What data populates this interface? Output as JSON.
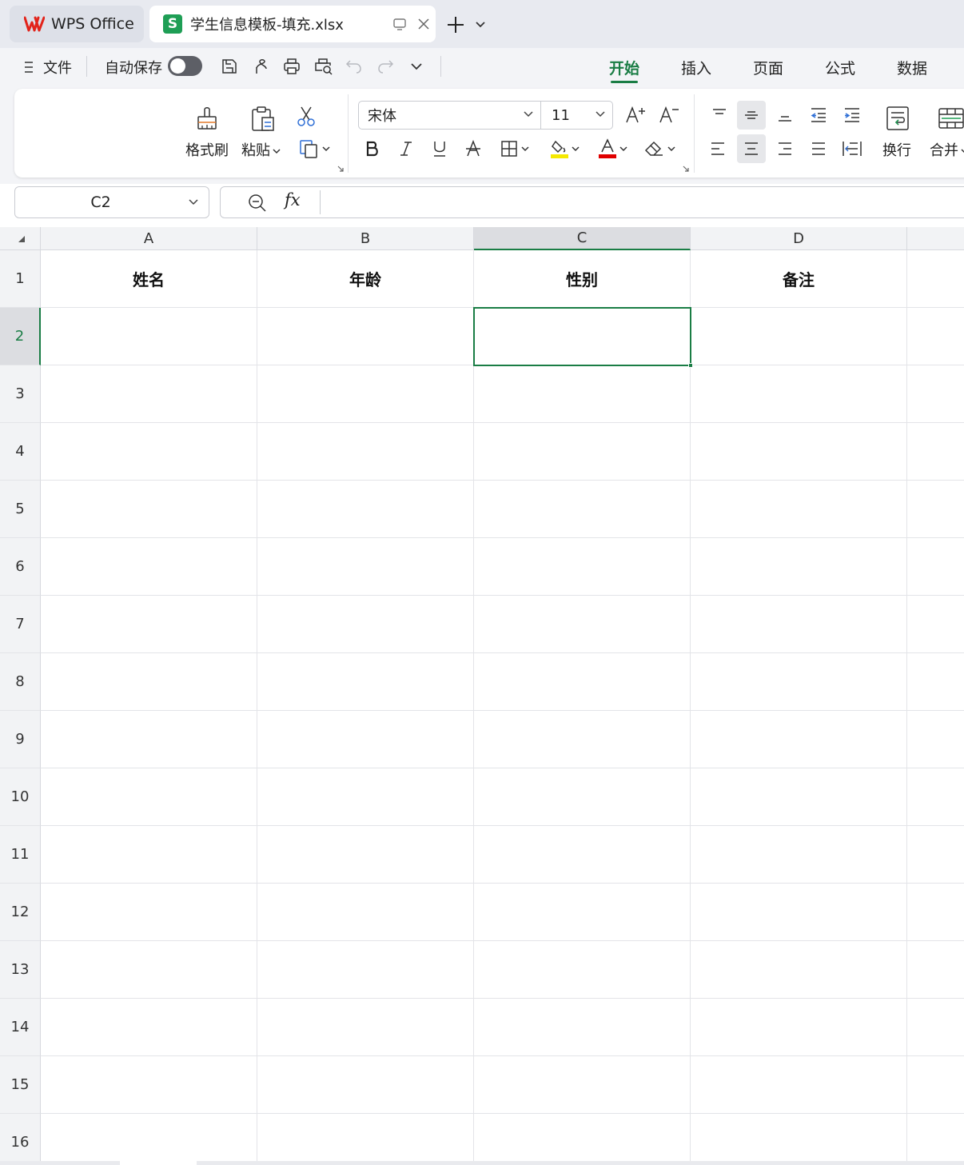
{
  "app": {
    "home_tab_label": "WPS Office",
    "doc_tab_title": "学生信息模板-填充.xlsx",
    "doc_tab_logo": "S",
    "brand_color": "#1a7d45"
  },
  "menubar": {
    "file_label": "文件",
    "autosave_label": "自动保存",
    "autosave_on": false,
    "ribbon_tabs": [
      "开始",
      "插入",
      "页面",
      "公式",
      "数据"
    ],
    "active_tab": "开始"
  },
  "ribbon": {
    "format_painter_label": "格式刷",
    "paste_label": "粘贴",
    "font_name": "宋体",
    "font_size": "11",
    "wrap_label": "换行",
    "merge_label": "合并",
    "fill_color": "#f5e900",
    "font_color": "#e00000"
  },
  "formula_bar": {
    "name_box": "C2",
    "fx_label": "fx",
    "formula": ""
  },
  "sheet": {
    "columns": [
      "A",
      "B",
      "C",
      "D"
    ],
    "rows": [
      "1",
      "2",
      "3",
      "4",
      "5",
      "6",
      "7",
      "8",
      "9",
      "10",
      "11",
      "12",
      "13",
      "14",
      "15",
      "16"
    ],
    "header_row": [
      "姓名",
      "年龄",
      "性别",
      "备注"
    ],
    "selected_cell": "C2",
    "selected_col": "C",
    "selected_row": "2"
  }
}
